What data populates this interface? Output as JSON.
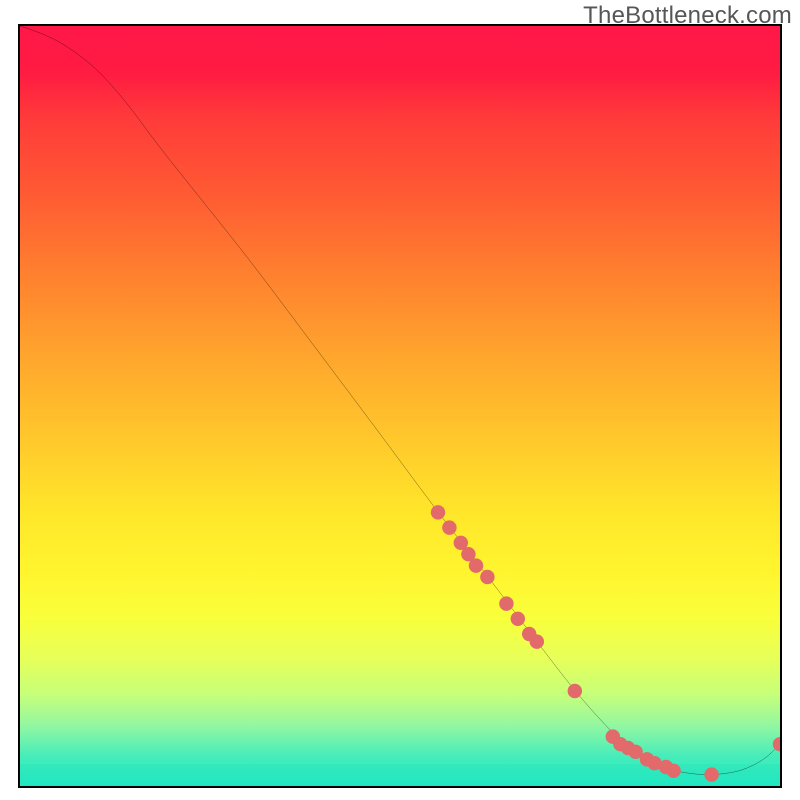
{
  "watermark": "TheBottleneck.com",
  "colors": {
    "gradient_top": "#ff1848",
    "gradient_bottom": "#20e7c2",
    "curve": "#000000",
    "dots": "#e26a6a",
    "border": "#000000",
    "watermark_text": "#565656"
  },
  "chart_data": {
    "type": "line",
    "title": "",
    "xlabel": "",
    "ylabel": "",
    "xlim": [
      0,
      100
    ],
    "ylim": [
      0,
      100
    ],
    "grid": false,
    "legend": false,
    "series": [
      {
        "name": "bottleneck-curve",
        "x": [
          0,
          3,
          6,
          10,
          14,
          18,
          24,
          30,
          36,
          42,
          48,
          55,
          62,
          68,
          73,
          77,
          80,
          83,
          86,
          89,
          92,
          95,
          98,
          100
        ],
        "y": [
          100,
          99,
          97.5,
          94.5,
          90,
          84.5,
          77,
          69.5,
          61.5,
          53.5,
          45.5,
          36,
          27,
          19,
          12.5,
          8,
          5,
          3,
          2,
          1.5,
          1.5,
          2,
          3.5,
          5.5
        ]
      }
    ],
    "markers": {
      "name": "highlighted-points",
      "x": [
        55,
        56.5,
        58,
        59,
        60,
        61.5,
        64,
        65.5,
        67,
        68,
        73,
        78,
        79,
        80,
        81,
        82.5,
        83.5,
        85,
        86,
        91,
        100
      ],
      "y": [
        36,
        34,
        32,
        30.5,
        29,
        27.5,
        24,
        22,
        20,
        19,
        12.5,
        6.5,
        5.5,
        5,
        4.5,
        3.5,
        3,
        2.5,
        2,
        1.5,
        5.5
      ]
    },
    "background": {
      "type": "vertical-gradient",
      "top": "red",
      "bottom": "teal"
    }
  }
}
